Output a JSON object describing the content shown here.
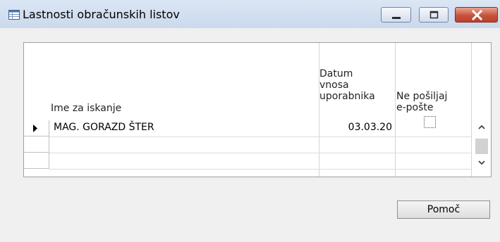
{
  "window": {
    "title": "Lastnosti obračunskih listov",
    "icon": "table-window-icon"
  },
  "grid": {
    "columns": [
      {
        "key": "name",
        "header": "Ime za iskanje"
      },
      {
        "key": "date",
        "header": "Datum\nvnosa\nuporabnika"
      },
      {
        "key": "nosend",
        "header": "Ne pošiljaj\ne-pošte"
      }
    ],
    "rows": [
      {
        "name": "MAG. GORAZD ŠTER",
        "date": "03.03.20",
        "nosend": false,
        "current": true
      }
    ]
  },
  "buttons": {
    "help_label": "Pomoč"
  },
  "colors": {
    "titlebar": "#cad9ec",
    "background": "#f0f0f0",
    "close_button": "#c8523c"
  }
}
